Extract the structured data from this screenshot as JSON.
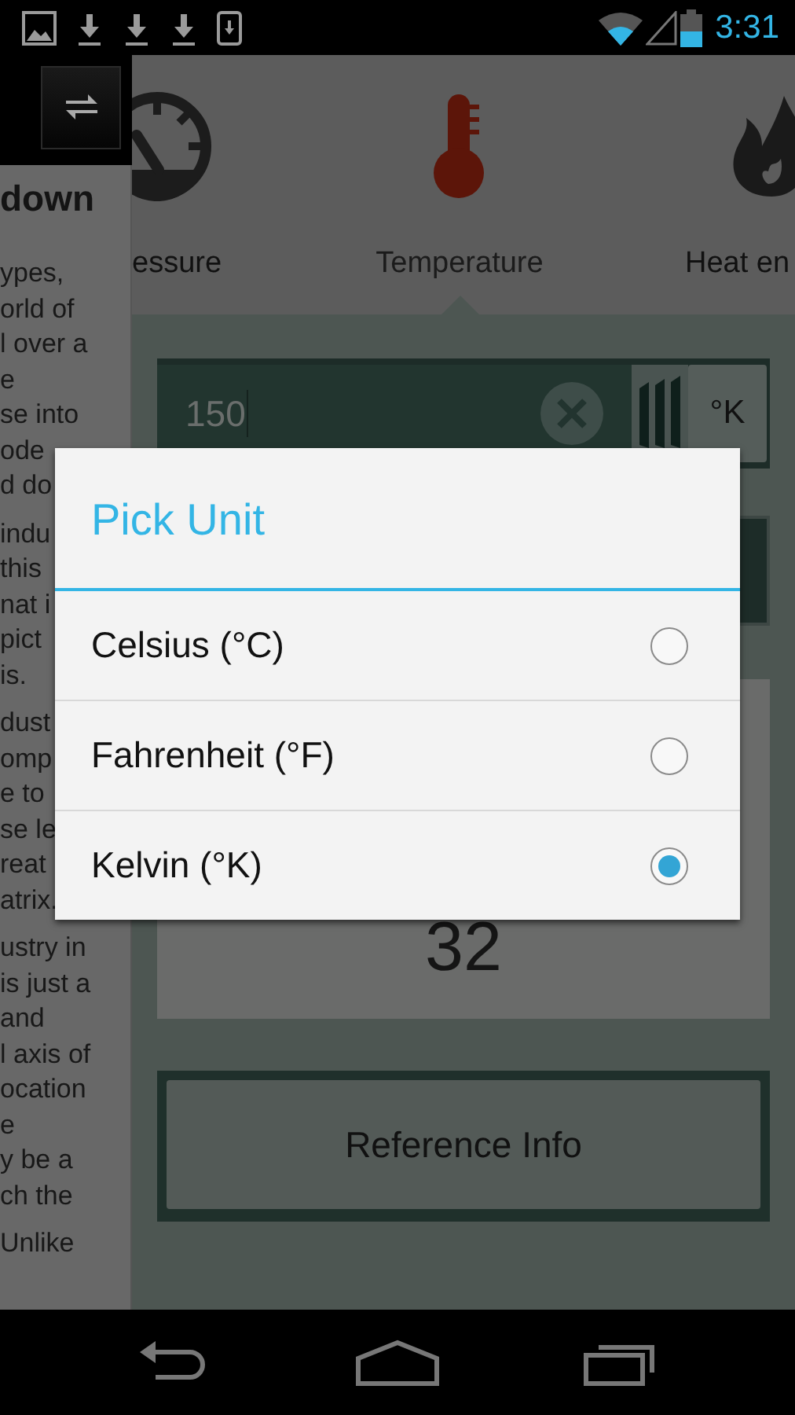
{
  "status_bar": {
    "time": "3:31"
  },
  "drawer": {
    "heading": "down",
    "paragraphs": [
      [
        "ypes,",
        "orld of",
        "l over a",
        "e",
        "se into",
        "ode",
        "d do"
      ],
      [
        "indu",
        "this",
        "nat i",
        "pict",
        "is."
      ],
      [
        "dust",
        "omp",
        "e to",
        "se le",
        "reat",
        "atrix."
      ],
      [
        "ustry in",
        "is just a",
        "and",
        "l axis of",
        "ocation",
        "e",
        "y be a",
        "ch the"
      ],
      [
        "Unlike"
      ]
    ]
  },
  "tabs": [
    {
      "label": "essure",
      "selected": false
    },
    {
      "label": "Temperature",
      "selected": true
    },
    {
      "label": "Heat en",
      "selected": false
    }
  ],
  "input": {
    "value": "150",
    "unit": "°K"
  },
  "result": {
    "value": "32"
  },
  "reference_button": {
    "label": "Reference Info"
  },
  "dialog": {
    "title": "Pick Unit",
    "options": [
      {
        "label": "Celsius (°C)",
        "selected": false
      },
      {
        "label": "Fahrenheit (°F)",
        "selected": false
      },
      {
        "label": "Kelvin (°K)",
        "selected": true
      }
    ]
  }
}
